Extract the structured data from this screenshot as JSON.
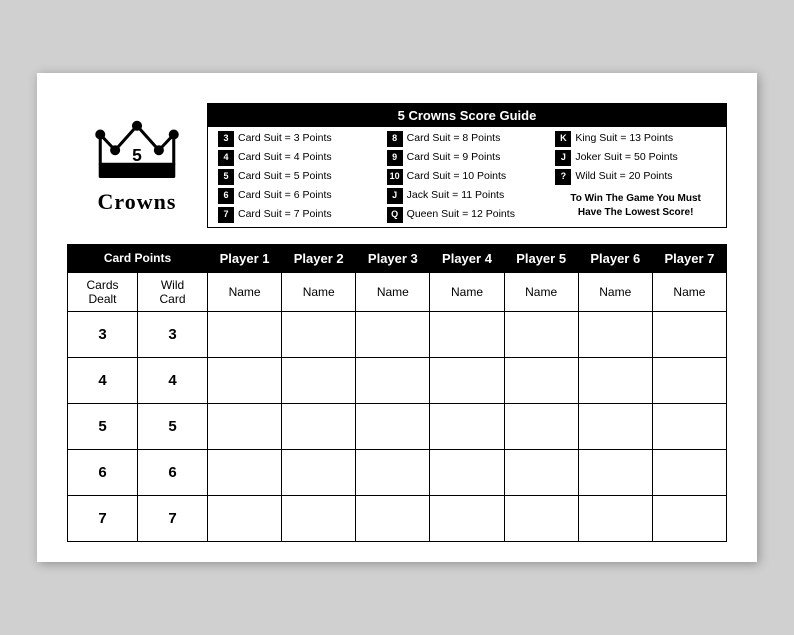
{
  "title": "5 Crowns Score Guide",
  "logo": {
    "number": "5",
    "name": "Crowns"
  },
  "scoreGuide": {
    "title": "5 Crowns Score Guide",
    "columns": [
      [
        {
          "badge": "3",
          "text": "Card Suit = 3 Points"
        },
        {
          "badge": "4",
          "text": "Card Suit = 4 Points"
        },
        {
          "badge": "5",
          "text": "Card Suit = 5 Points"
        },
        {
          "badge": "6",
          "text": "Card Suit = 6 Points"
        },
        {
          "badge": "7",
          "text": "Card Suit = 7 Points"
        }
      ],
      [
        {
          "badge": "8",
          "text": "Card Suit = 8 Points"
        },
        {
          "badge": "9",
          "text": "Card Suit = 9 Points"
        },
        {
          "badge": "10",
          "text": "Card Suit = 10 Points"
        },
        {
          "badge": "J",
          "text": "Jack Suit = 11 Points"
        },
        {
          "badge": "Q",
          "text": "Queen Suit = 12 Points"
        }
      ],
      [
        {
          "badge": "K",
          "text": "King Suit = 13 Points"
        },
        {
          "badge": "J",
          "text": "Joker Suit = 50 Points"
        },
        {
          "badge": "?",
          "text": "Wild Suit = 20 Points"
        },
        {
          "badge": null,
          "text": "To Win The Game You Must Have The Lowest Score!"
        }
      ]
    ]
  },
  "table": {
    "players": [
      "Player 1",
      "Player 2",
      "Player 3",
      "Player 4",
      "Player 5",
      "Player 6",
      "Player 7"
    ],
    "nameLabel": "Name",
    "col1Header": "Cards\nDealt",
    "col2Header": "Wild\nCard",
    "rows": [
      {
        "dealt": "3",
        "wild": "3"
      },
      {
        "dealt": "4",
        "wild": "4"
      },
      {
        "dealt": "5",
        "wild": "5"
      },
      {
        "dealt": "6",
        "wild": "6"
      },
      {
        "dealt": "7",
        "wild": "7"
      }
    ]
  }
}
